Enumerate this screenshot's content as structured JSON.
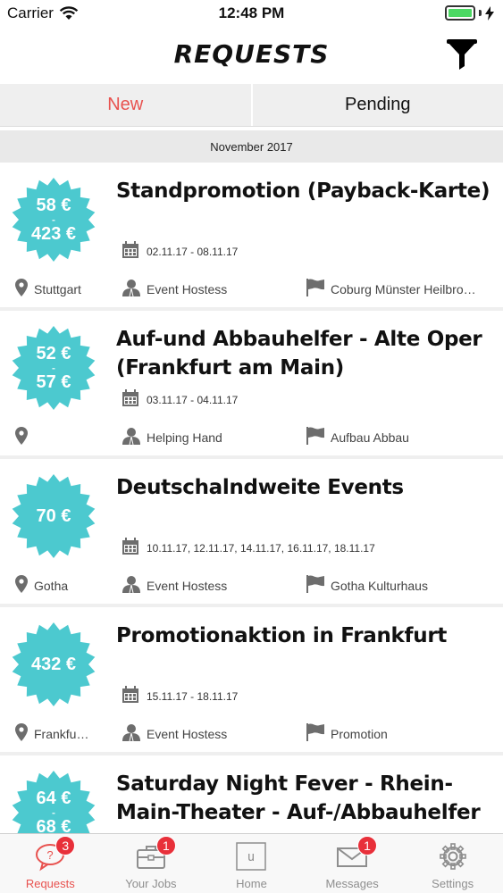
{
  "status_bar": {
    "carrier": "Carrier",
    "time": "12:48 PM"
  },
  "nav": {
    "title": "REQUESTS"
  },
  "tabs": [
    {
      "label": "New",
      "active": true
    },
    {
      "label": "Pending",
      "active": false
    }
  ],
  "section_header": "November 2017",
  "accent_color": "#e8524f",
  "badge_color": "#4cc9cf",
  "requests": [
    {
      "price_min": "58 €",
      "price_max": "423 €",
      "separator": "-",
      "title": "Standpromotion (Payback-Karte)",
      "dates": "02.11.17 - 08.11.17",
      "location": "Stuttgart",
      "role": "Event Hostess",
      "tag": "Coburg Münster Heilbro…"
    },
    {
      "price_min": "52 €",
      "price_max": "57 €",
      "separator": "-",
      "title": "Auf-und Abbauhelfer - Alte Oper (Frankfurt am Main)",
      "dates": "03.11.17 - 04.11.17",
      "location": "",
      "role": "Helping Hand",
      "tag": "Aufbau Abbau"
    },
    {
      "price_min": "70 €",
      "price_max": "",
      "separator": "",
      "title": "Deutschalndweite Events",
      "dates": "10.11.17, 12.11.17, 14.11.17, 16.11.17, 18.11.17",
      "location": "Gotha",
      "role": "Event Hostess",
      "tag": "Gotha Kulturhaus"
    },
    {
      "price_min": "432 €",
      "price_max": "",
      "separator": "",
      "title": "Promotionaktion in Frankfurt",
      "dates": "15.11.17 - 18.11.17",
      "location": "Frankfu…",
      "role": "Event Hostess",
      "tag": "Promotion"
    },
    {
      "price_min": "64 €",
      "price_max": "68 €",
      "separator": "-",
      "title": "Saturday Night Fever - Rhein-Main-Theater - Auf-/Abbauhelfer",
      "dates": "",
      "location": "",
      "role": "",
      "tag": ""
    }
  ],
  "tab_bar": [
    {
      "label": "Requests",
      "icon": "question-bubble-icon",
      "badge": "3",
      "active": true
    },
    {
      "label": "Your Jobs",
      "icon": "briefcase-icon",
      "badge": "1",
      "active": false
    },
    {
      "label": "Home",
      "icon": "home-u-icon",
      "badge": "",
      "active": false
    },
    {
      "label": "Messages",
      "icon": "envelope-icon",
      "badge": "1",
      "active": false
    },
    {
      "label": "Settings",
      "icon": "gear-icon",
      "badge": "",
      "active": false
    }
  ]
}
